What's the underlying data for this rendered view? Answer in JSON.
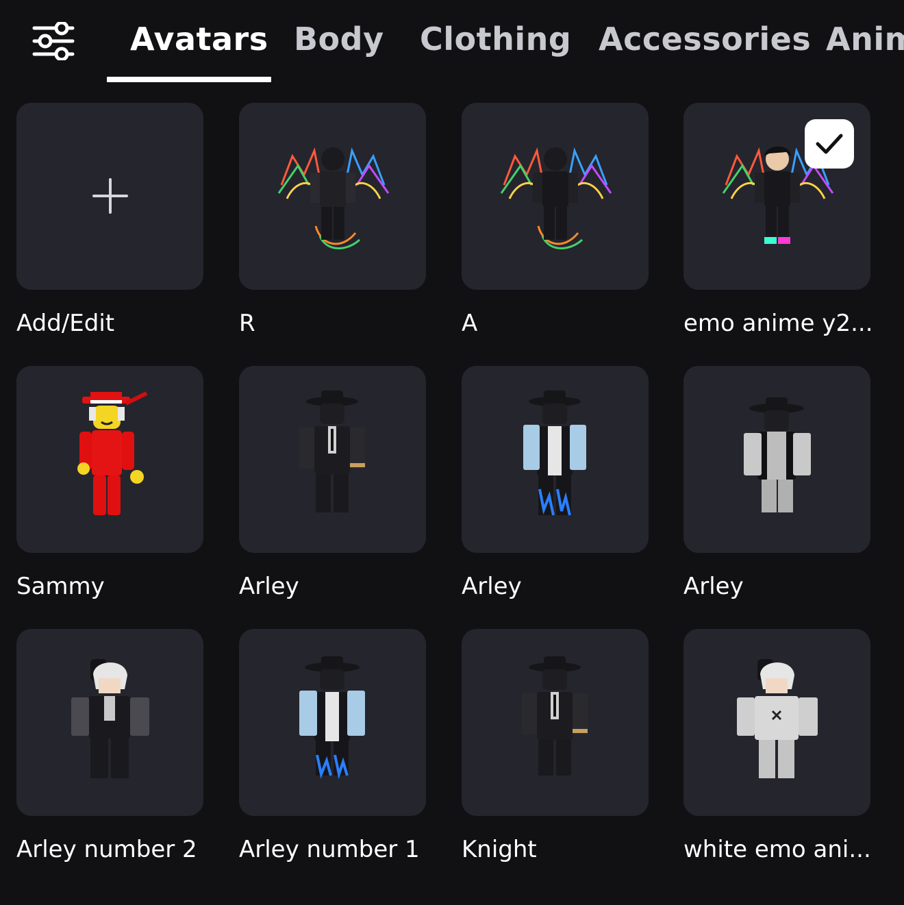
{
  "tabs": [
    {
      "label": "Avatars",
      "active": true
    },
    {
      "label": "Body"
    },
    {
      "label": "Clothing"
    },
    {
      "label": "Accessories"
    },
    {
      "label": "Anim"
    }
  ],
  "avatars": [
    {
      "name": "Add/Edit",
      "icon": "plus-icon"
    },
    {
      "name": "R",
      "icon": "rainbow-dragon-avatar"
    },
    {
      "name": "A",
      "icon": "rainbow-dragon-avatar"
    },
    {
      "name": "emo anime y2...",
      "icon": "rainbow-dragon-avatar",
      "selected": true
    },
    {
      "name": "Sammy",
      "icon": "red-suit-avatar"
    },
    {
      "name": "Arley",
      "icon": "black-coat-avatar"
    },
    {
      "name": "Arley",
      "icon": "blue-sleeve-avatar"
    },
    {
      "name": "Arley",
      "icon": "grey-coat-avatar"
    },
    {
      "name": "Arley number 2",
      "icon": "white-hair-black-suit-avatar"
    },
    {
      "name": "Arley number 1",
      "icon": "blue-sleeve-avatar"
    },
    {
      "name": "Knight",
      "icon": "black-coat-avatar"
    },
    {
      "name": "white emo ani...",
      "icon": "white-hair-white-outfit-avatar"
    }
  ],
  "colors": {
    "background": "#111114",
    "card": "#25252d",
    "text": "#ffffff",
    "tab_inactive": "#c8c8cf"
  }
}
